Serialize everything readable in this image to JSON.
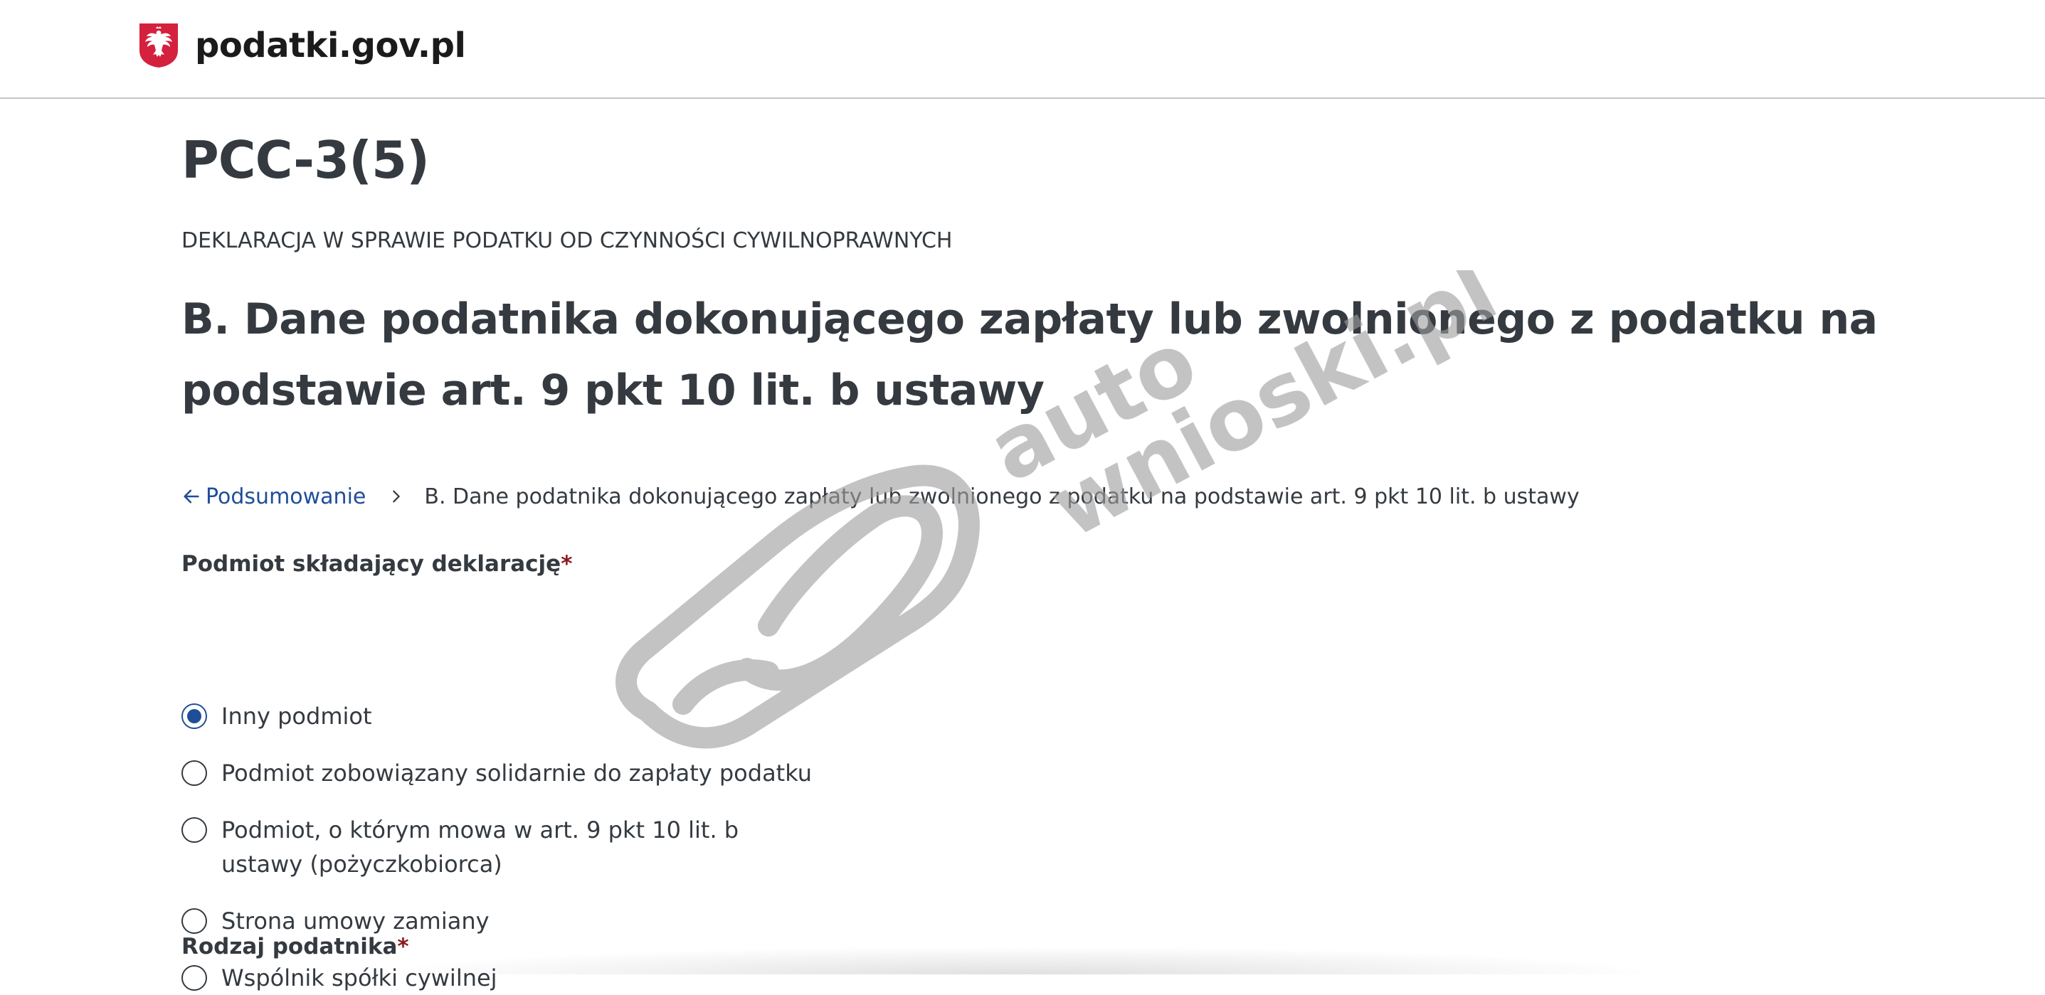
{
  "header": {
    "site_name": "podatki.gov.pl",
    "logo_icon": "polish-eagle-emblem-icon"
  },
  "form": {
    "code": "PCC-3(5)",
    "subtitle": "DEKLARACJA W SPRAWIE PODATKU OD CZYNNOŚCI CYWILNOPRAWNYCH",
    "section_title": "B. Dane podatnika dokonującego zapłaty lub zwolnionego z podatku na podstawie art. 9 pkt 10 lit. b ustawy"
  },
  "breadcrumb": {
    "back_label": "Podsumowanie",
    "current": "B. Dane podatnika dokonującego zapłaty lub zwolnionego z podatku na podstawie art. 9 pkt 10 lit. b ustawy"
  },
  "declarant": {
    "label": "Podmiot składający deklarację",
    "required_mark": "*",
    "options": [
      {
        "label": "Inny podmiot",
        "selected": true
      },
      {
        "label": "Podmiot zobowiązany solidarnie do zapłaty podatku",
        "selected": false
      },
      {
        "label": "Podmiot, o którym mowa w art. 9 pkt 10 lit. b ustawy (pożyczkobiorca)",
        "selected": false
      },
      {
        "label": "Strona umowy zamiany",
        "selected": false
      },
      {
        "label": "Wspólnik spółki cywilnej",
        "selected": false
      }
    ]
  },
  "taxpayer_type": {
    "label": "Rodzaj podatnika",
    "required_mark": "*"
  },
  "watermark": {
    "line1": "auto",
    "line2": "wnioski.pl"
  },
  "colors": {
    "accent": "#1f4e99",
    "text": "#343a40",
    "required": "#8b1a1a",
    "emblem_red": "#d4213d",
    "watermark": "#9e9e9e"
  }
}
